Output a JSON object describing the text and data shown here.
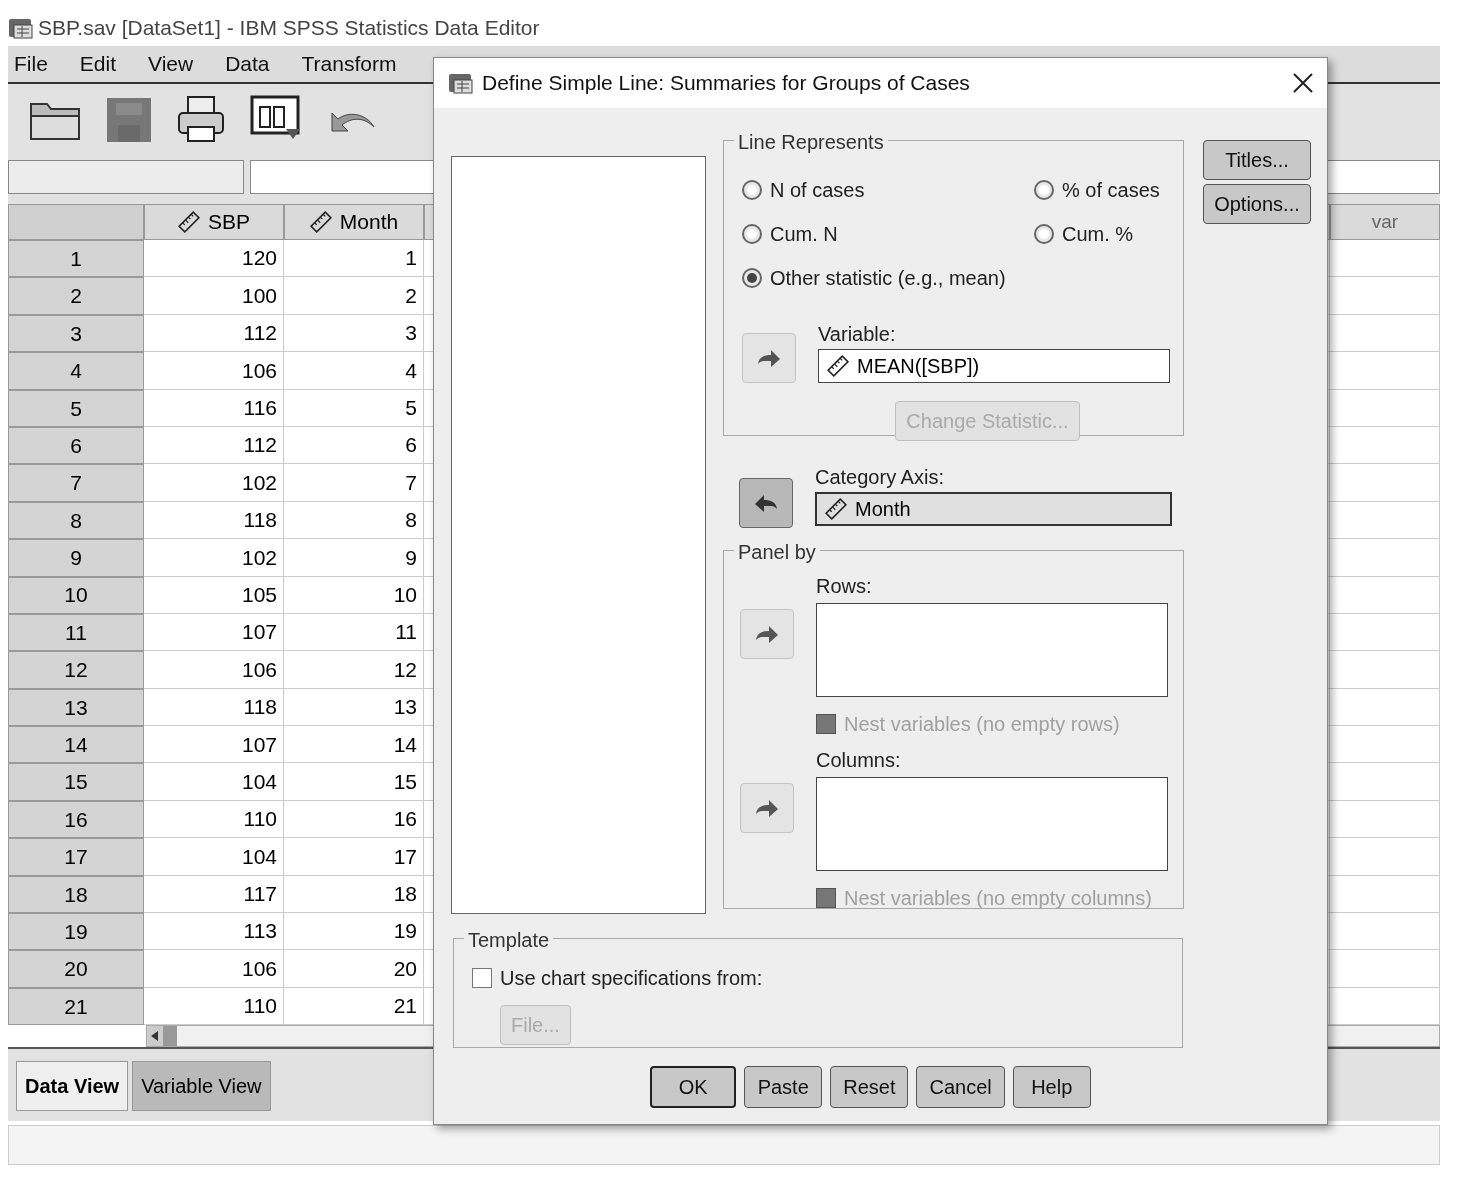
{
  "window": {
    "title": "SBP.sav [DataSet1] - IBM SPSS Statistics Data Editor"
  },
  "menu": [
    {
      "label": "File"
    },
    {
      "label": "Edit"
    },
    {
      "label": "View"
    },
    {
      "label": "Data"
    },
    {
      "label": "Transform"
    }
  ],
  "grid": {
    "columns": [
      "SBP",
      "Month"
    ],
    "extra_column": "var",
    "rows": [
      {
        "num": "1",
        "cells": [
          "120",
          "1"
        ]
      },
      {
        "num": "2",
        "cells": [
          "100",
          "2"
        ]
      },
      {
        "num": "3",
        "cells": [
          "112",
          "3"
        ]
      },
      {
        "num": "4",
        "cells": [
          "106",
          "4"
        ]
      },
      {
        "num": "5",
        "cells": [
          "116",
          "5"
        ]
      },
      {
        "num": "6",
        "cells": [
          "112",
          "6"
        ]
      },
      {
        "num": "7",
        "cells": [
          "102",
          "7"
        ]
      },
      {
        "num": "8",
        "cells": [
          "118",
          "8"
        ]
      },
      {
        "num": "9",
        "cells": [
          "102",
          "9"
        ]
      },
      {
        "num": "10",
        "cells": [
          "105",
          "10"
        ]
      },
      {
        "num": "11",
        "cells": [
          "107",
          "11"
        ]
      },
      {
        "num": "12",
        "cells": [
          "106",
          "12"
        ]
      },
      {
        "num": "13",
        "cells": [
          "118",
          "13"
        ]
      },
      {
        "num": "14",
        "cells": [
          "107",
          "14"
        ]
      },
      {
        "num": "15",
        "cells": [
          "104",
          "15"
        ]
      },
      {
        "num": "16",
        "cells": [
          "110",
          "16"
        ]
      },
      {
        "num": "17",
        "cells": [
          "104",
          "17"
        ]
      },
      {
        "num": "18",
        "cells": [
          "117",
          "18"
        ]
      },
      {
        "num": "19",
        "cells": [
          "113",
          "19"
        ]
      },
      {
        "num": "20",
        "cells": [
          "106",
          "20"
        ]
      },
      {
        "num": "21",
        "cells": [
          "110",
          "21"
        ]
      }
    ]
  },
  "view_tabs": [
    {
      "label": "Data View",
      "selected": true
    },
    {
      "label": "Variable View",
      "selected": false
    }
  ],
  "dialog": {
    "title": "Define Simple Line: Summaries for Groups of Cases",
    "line_represents": {
      "title": "Line Represents",
      "options": [
        {
          "label": "N of cases",
          "selected": false
        },
        {
          "label": "% of cases",
          "selected": false
        },
        {
          "label": "Cum. N",
          "selected": false
        },
        {
          "label": "Cum. %",
          "selected": false
        },
        {
          "label": "Other statistic (e.g., mean)",
          "selected": true
        }
      ]
    },
    "variable": {
      "label": "Variable:",
      "value": "MEAN([SBP])"
    },
    "change_statistic": {
      "label": "Change Statistic...",
      "disabled": true
    },
    "category_axis": {
      "label": "Category Axis:",
      "value": "Month"
    },
    "panel_by": {
      "title": "Panel by",
      "rows_label": "Rows:",
      "nest_rows": {
        "label": "Nest variables (no empty rows)",
        "checked": false,
        "disabled": true
      },
      "columns_label": "Columns:",
      "nest_columns": {
        "label": "Nest variables (no empty columns)",
        "checked": false,
        "disabled": true
      }
    },
    "template": {
      "title": "Template",
      "checkbox": {
        "label": "Use chart specifications from:",
        "checked": false
      },
      "file_button": {
        "label": "File...",
        "disabled": true
      }
    },
    "side_buttons": [
      "Titles...",
      "Options..."
    ],
    "buttons": [
      {
        "label": "OK",
        "kind": "default"
      },
      {
        "label": "Paste",
        "kind": "normal"
      },
      {
        "label": "Reset",
        "kind": "normal"
      },
      {
        "label": "Cancel",
        "kind": "normal"
      },
      {
        "label": "Help",
        "kind": "normal"
      }
    ]
  }
}
